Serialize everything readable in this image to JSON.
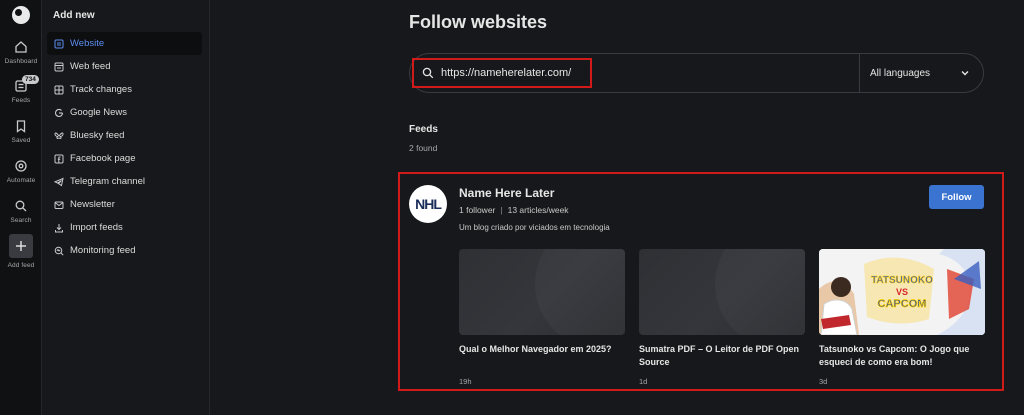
{
  "rail": {
    "items": [
      {
        "label": "Dashboard",
        "icon": "home-icon"
      },
      {
        "label": "Feeds",
        "icon": "feeds-icon",
        "badge": "734"
      },
      {
        "label": "Saved",
        "icon": "bookmark-icon"
      },
      {
        "label": "Automate",
        "icon": "automate-icon"
      },
      {
        "label": "Search",
        "icon": "search-icon"
      },
      {
        "label": "Add feed",
        "icon": "plus-icon"
      }
    ]
  },
  "sidebar": {
    "title": "Add new",
    "items": [
      {
        "label": "Website",
        "icon": "website-icon"
      },
      {
        "label": "Web feed",
        "icon": "rss-icon"
      },
      {
        "label": "Track changes",
        "icon": "track-changes-icon"
      },
      {
        "label": "Google News",
        "icon": "google-icon"
      },
      {
        "label": "Bluesky feed",
        "icon": "bluesky-icon"
      },
      {
        "label": "Facebook page",
        "icon": "facebook-icon"
      },
      {
        "label": "Telegram channel",
        "icon": "telegram-icon"
      },
      {
        "label": "Newsletter",
        "icon": "newsletter-icon"
      },
      {
        "label": "Import feeds",
        "icon": "import-icon"
      },
      {
        "label": "Monitoring feed",
        "icon": "monitoring-icon"
      }
    ]
  },
  "main": {
    "title": "Follow websites",
    "search": {
      "value": "https://nameherelater.com/"
    },
    "language": "All languages",
    "feeds_heading": "Feeds",
    "feeds_count": "2 found",
    "feed": {
      "logo_text": "NHL",
      "name": "Name Here Later",
      "followers": "1 follower",
      "articles_per_week": "13 articles/week",
      "description": "Um blog criado por viciados em tecnologia",
      "follow_label": "Follow",
      "articles": [
        {
          "title": "Qual o Melhor Navegador em 2025?",
          "time": "19h"
        },
        {
          "title": "Sumatra PDF – O Leitor de PDF Open Source",
          "time": "1d"
        },
        {
          "title": "Tatsunoko vs Capcom: O Jogo que esqueci de como era bom!",
          "time": "3d",
          "thumb_text": [
            "TATSUNOKO",
            "VS",
            "CAPCOM"
          ]
        }
      ]
    }
  },
  "colors": {
    "accent": "#5b8def",
    "follow_button": "#3a73d0",
    "highlight": "#d21a1a"
  }
}
